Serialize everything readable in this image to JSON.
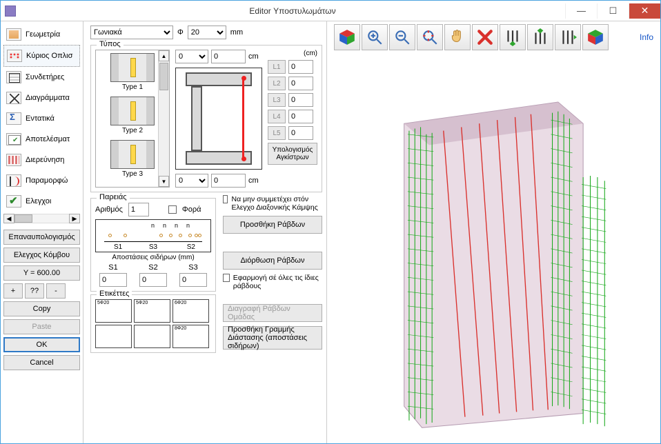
{
  "window": {
    "title": "Editor Υποστυλωμάτων"
  },
  "sidebar": {
    "items": [
      {
        "label": "Γεωμετρία",
        "icon": "geom"
      },
      {
        "label": "Κύριος Οπλισ",
        "icon": "rebar",
        "selected": true
      },
      {
        "label": "Συνδετήρες",
        "icon": "tie"
      },
      {
        "label": "Διαγράμματα",
        "icon": "diag"
      },
      {
        "label": "Εντατικά",
        "icon": "sigma"
      },
      {
        "label": "Αποτελέσματ",
        "icon": "res"
      },
      {
        "label": "Διερεύνηση",
        "icon": "inv"
      },
      {
        "label": "Παραμορφώ",
        "icon": "def"
      },
      {
        "label": "Ελεγχοι",
        "icon": "chk"
      }
    ],
    "recalc": "Επαναυπολογισμός",
    "joint_check": "Ελεγχος Κόμβου",
    "y_label": "Y = 600.00",
    "plus": "+",
    "query": "??",
    "minus": "-",
    "copy": "Copy",
    "paste": "Paste",
    "ok": "OK",
    "cancel": "Cancel"
  },
  "topbar": {
    "layout": "Γωνιακά",
    "phi": "Φ",
    "diam": "20",
    "unit": "mm"
  },
  "types": {
    "legend": "Τύπος",
    "items": [
      {
        "label": "Type 1"
      },
      {
        "label": "Type 2"
      },
      {
        "label": "Type 3"
      }
    ],
    "dim_top_sel": "0",
    "dim_top_val": "0",
    "dim_bot_sel": "0",
    "dim_bot_val": "0",
    "cm": "cm",
    "cm_hdr": "(cm)",
    "L": [
      {
        "name": "L1",
        "val": "0"
      },
      {
        "name": "L2",
        "val": "0"
      },
      {
        "name": "L3",
        "val": "0"
      },
      {
        "name": "L4",
        "val": "0"
      },
      {
        "name": "L5",
        "val": "0"
      }
    ],
    "hooks_btn": "Υπολογισμός Αγκίστρων"
  },
  "pareias": {
    "legend": "Παρειάς",
    "count_label": "Αριθμός",
    "count": "1",
    "fora": "Φορά",
    "spacing_header": "Αποστάσεις σιδήρων (mm)",
    "s": [
      {
        "name": "S1",
        "val": "0"
      },
      {
        "name": "S2",
        "val": "0"
      },
      {
        "name": "S3",
        "val": "0"
      }
    ]
  },
  "labels": {
    "legend": "Ετικέττες",
    "tags": [
      "5Φ20",
      "5Φ20",
      "6Φ20",
      "",
      "",
      "8Φ20"
    ]
  },
  "actions": {
    "exclude": "Να μην συμμετέχει στόν Ελεγχο Διαξονικής Κάμψης",
    "add": "Προσθήκη Ράβδων",
    "fix": "Διόρθωση Ράβδων",
    "apply_all": "Εφαρμογή σέ όλες τις ίδιες ράβδους",
    "delete_group": "Διαγραφή Ράβδων Ομάδας",
    "add_dim_line": "Προσθήκη Γραμμής Διάστασης (αποστάσεις σιδήρων)"
  },
  "right": {
    "info": "Info"
  }
}
